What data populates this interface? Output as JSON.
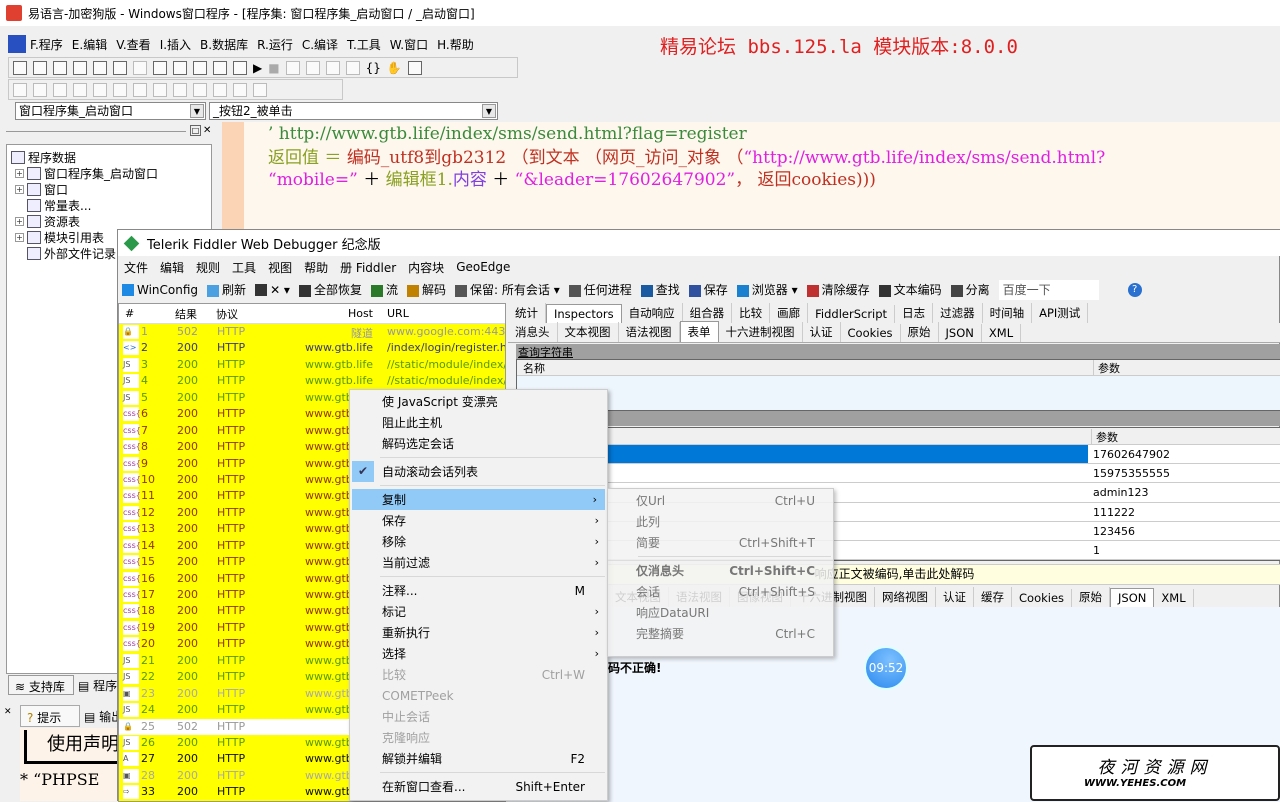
{
  "ide": {
    "title": "易语言-加密狗版 - Windows窗口程序 - [程序集: 窗口程序集_启动窗口 / _启动窗口]",
    "menu": [
      "F.程序",
      "E.编辑",
      "V.查看",
      "I.插入",
      "B.数据库",
      "R.运行",
      "C.编译",
      "T.工具",
      "W.窗口",
      "H.帮助"
    ],
    "forum_banner": "精易论坛 bbs.125.la 模块版本:8.0.0",
    "combo_class": "窗口程序集_启动窗口",
    "combo_method": "_按钮2_被单击",
    "tree": [
      {
        "label": "程序数据",
        "expand": false,
        "indent": 0
      },
      {
        "label": "窗口程序集_启动窗口",
        "expand": true,
        "indent": 1
      },
      {
        "label": "窗口",
        "expand": true,
        "indent": 1
      },
      {
        "label": "常量表...",
        "expand": false,
        "indent": 1
      },
      {
        "label": "资源表",
        "expand": true,
        "indent": 1
      },
      {
        "label": "模块引用表",
        "expand": true,
        "indent": 1
      },
      {
        "label": "外部文件记录",
        "expand": false,
        "indent": 1
      }
    ],
    "code": {
      "line1": "’ http://www.gtb.life/index/sms/send.html?flag=register",
      "l2_a": "返回值 ＝ ",
      "l2_b": "编码_utf8到gb2312 （到文本 （网页_访问_对象 （",
      "l2_c": "“http://www.gtb.life/index/sms/send.html?",
      "l3_a": "“mobile=”",
      "l3_b": " ＋ ",
      "l3_c": "编辑框1.",
      "l3_d": "内容",
      "l3_e": " ＋ ",
      "l3_f": "“&leader=17602647902”",
      "l3_g": "， 返回cookies)))"
    },
    "bottom_tabs": [
      "支持库",
      "程序"
    ],
    "bottom_tabs2": [
      "提示",
      "输出"
    ],
    "notice_title": "使用声明",
    "notice_line": "* “PHPSE"
  },
  "fiddler": {
    "title": "Telerik Fiddler Web Debugger 纪念版",
    "menu": [
      "文件",
      "编辑",
      "规则",
      "工具",
      "视图",
      "帮助",
      "册 Fiddler",
      "内容块",
      "GeoEdge"
    ],
    "toolbar": [
      "WinConfig",
      "刷新",
      "✕ ▾",
      "全部恢复",
      "流",
      "解码",
      "保留: 所有会话 ▾",
      "任何进程",
      "查找",
      "保存",
      "浏览器 ▾",
      "清除缓存",
      "文本编码",
      "分离"
    ],
    "search_placeholder": "百度一下",
    "columns": [
      "#",
      "结果",
      "协议",
      "Host",
      "URL"
    ],
    "sessions": [
      {
        "n": "1",
        "r": "502",
        "p": "HTTP",
        "h": "隧道",
        "u": "www.google.com:443",
        "t": "tun",
        "icon": "lock"
      },
      {
        "n": "2",
        "r": "200",
        "p": "HTTP",
        "h": "www.gtb.life",
        "u": "/index/login/register.html",
        "t": "html",
        "icon": "html"
      },
      {
        "n": "3",
        "r": "200",
        "p": "HTTP",
        "h": "www.gtb.life",
        "u": "//static/module/index/js/j",
        "t": "js",
        "icon": "js"
      },
      {
        "n": "4",
        "r": "200",
        "p": "HTTP",
        "h": "www.gtb.life",
        "u": "//static/module/index/js/b",
        "t": "js",
        "icon": "js"
      },
      {
        "n": "5",
        "r": "200",
        "p": "HTTP",
        "h": "www.gtb.life",
        "u": "",
        "t": "js",
        "icon": "js"
      },
      {
        "n": "6",
        "r": "200",
        "p": "HTTP",
        "h": "www.gtb.life",
        "u": "",
        "t": "css",
        "icon": "css"
      },
      {
        "n": "7",
        "r": "200",
        "p": "HTTP",
        "h": "www.gtb.life",
        "u": "",
        "t": "css",
        "icon": "css"
      },
      {
        "n": "8",
        "r": "200",
        "p": "HTTP",
        "h": "www.gtb.life",
        "u": "",
        "t": "css",
        "icon": "css"
      },
      {
        "n": "9",
        "r": "200",
        "p": "HTTP",
        "h": "www.gtb.life",
        "u": "",
        "t": "css",
        "icon": "css"
      },
      {
        "n": "10",
        "r": "200",
        "p": "HTTP",
        "h": "www.gtb.life",
        "u": "",
        "t": "css",
        "icon": "css"
      },
      {
        "n": "11",
        "r": "200",
        "p": "HTTP",
        "h": "www.gtb.life",
        "u": "",
        "t": "css",
        "icon": "css"
      },
      {
        "n": "12",
        "r": "200",
        "p": "HTTP",
        "h": "www.gtb.life",
        "u": "",
        "t": "css",
        "icon": "css"
      },
      {
        "n": "13",
        "r": "200",
        "p": "HTTP",
        "h": "www.gtb.life",
        "u": "",
        "t": "css",
        "icon": "css"
      },
      {
        "n": "14",
        "r": "200",
        "p": "HTTP",
        "h": "www.gtb.life",
        "u": "",
        "t": "css",
        "icon": "css"
      },
      {
        "n": "15",
        "r": "200",
        "p": "HTTP",
        "h": "www.gtb.life",
        "u": "",
        "t": "css",
        "icon": "css"
      },
      {
        "n": "16",
        "r": "200",
        "p": "HTTP",
        "h": "www.gtb.life",
        "u": "",
        "t": "css",
        "icon": "css"
      },
      {
        "n": "17",
        "r": "200",
        "p": "HTTP",
        "h": "www.gtb.life",
        "u": "",
        "t": "css",
        "icon": "css"
      },
      {
        "n": "18",
        "r": "200",
        "p": "HTTP",
        "h": "www.gtb.life",
        "u": "",
        "t": "css",
        "icon": "css"
      },
      {
        "n": "19",
        "r": "200",
        "p": "HTTP",
        "h": "www.gtb.life",
        "u": "",
        "t": "css",
        "icon": "css"
      },
      {
        "n": "20",
        "r": "200",
        "p": "HTTP",
        "h": "www.gtb.life",
        "u": "",
        "t": "css",
        "icon": "css"
      },
      {
        "n": "21",
        "r": "200",
        "p": "HTTP",
        "h": "www.gtb.life",
        "u": "",
        "t": "js",
        "icon": "js"
      },
      {
        "n": "22",
        "r": "200",
        "p": "HTTP",
        "h": "www.gtb.life",
        "u": "",
        "t": "js",
        "icon": "js"
      },
      {
        "n": "23",
        "r": "200",
        "p": "HTTP",
        "h": "www.gtb.life",
        "u": "",
        "t": "img",
        "icon": "image"
      },
      {
        "n": "24",
        "r": "200",
        "p": "HTTP",
        "h": "www.gtb.life",
        "u": "",
        "t": "js",
        "icon": "js"
      },
      {
        "n": "25",
        "r": "502",
        "p": "HTTP",
        "h": "",
        "u": "",
        "t": "tun",
        "icon": "lock",
        "white": true
      },
      {
        "n": "26",
        "r": "200",
        "p": "HTTP",
        "h": "www.gtb.life",
        "u": "",
        "t": "js",
        "icon": "js"
      },
      {
        "n": "27",
        "r": "200",
        "p": "HTTP",
        "h": "www.gtb.life",
        "u": "",
        "t": "blk",
        "icon": "font"
      },
      {
        "n": "28",
        "r": "200",
        "p": "HTTP",
        "h": "www.gtb.life",
        "u": "",
        "t": "img",
        "icon": "image"
      },
      {
        "n": "33",
        "r": "200",
        "p": "HTTP",
        "h": "www.gtb.life",
        "u": "",
        "t": "blk",
        "icon": "redirect"
      }
    ],
    "main_tabs": [
      "统计",
      "Inspectors",
      "自动响应",
      "组合器",
      "比较",
      "画廊",
      "FiddlerScript",
      "日志",
      "过滤器",
      "时间轴",
      "API测试"
    ],
    "main_tab_selected": 1,
    "request_tabs": [
      "消息头",
      "文本视图",
      "语法视图",
      "表单",
      "十六进制视图",
      "认证",
      "Cookies",
      "原始",
      "JSON",
      "XML"
    ],
    "request_tab_selected": 3,
    "query_string_label": "查询字符串",
    "query_cols": [
      "名称",
      "参数"
    ],
    "body_cols": [
      "参数"
    ],
    "body_params": [
      "17602647902",
      "15975355555",
      "admin123",
      "111222",
      "123456",
      "1"
    ],
    "decode_bar": "响应正文被编码,单击此处解码",
    "response_tabs": [
      "文本视图",
      "语法视图",
      "图像视图",
      "十六进制视图",
      "网络视图",
      "认证",
      "缓存",
      "Cookies",
      "原始",
      "JSON",
      "XML"
    ],
    "response_tab_selected": 9,
    "response_text": "码不正确!"
  },
  "context_menu": [
    {
      "label": "使 JavaScript 变漂亮"
    },
    {
      "label": "阻止此主机"
    },
    {
      "label": "解码选定会话"
    },
    {
      "sep": true
    },
    {
      "label": "自动滚动会话列表",
      "checked": true
    },
    {
      "sep": true
    },
    {
      "label": "复制",
      "sub": true,
      "hl": true
    },
    {
      "label": "保存",
      "sub": true
    },
    {
      "label": "移除",
      "sub": true
    },
    {
      "label": "当前过滤",
      "sub": true
    },
    {
      "sep": true
    },
    {
      "label": "注释...",
      "sc": "M"
    },
    {
      "label": "标记",
      "sub": true
    },
    {
      "label": "重新执行",
      "sub": true
    },
    {
      "label": "选择",
      "sub": true
    },
    {
      "label": "比较",
      "sc": "Ctrl+W",
      "dis": true
    },
    {
      "label": "COMETPeek",
      "dis": true
    },
    {
      "label": "中止会话",
      "dis": true
    },
    {
      "label": "克隆响应",
      "dis": true
    },
    {
      "label": "解锁并编辑",
      "sc": "F2"
    },
    {
      "sep": true
    },
    {
      "label": "在新窗口查看...",
      "sc": "Shift+Enter"
    }
  ],
  "copy_submenu": [
    {
      "label": "仅Url",
      "sc": "Ctrl+U"
    },
    {
      "label": "此列"
    },
    {
      "label": "简要",
      "sc": "Ctrl+Shift+T"
    },
    {
      "sep": true
    },
    {
      "label": "仅消息头",
      "sc": "Ctrl+Shift+C",
      "bold": true
    },
    {
      "label": "会话",
      "sc": "Ctrl+Shift+S"
    },
    {
      "label": "响应DataURI"
    },
    {
      "label": "完整摘要",
      "sc": "Ctrl+C"
    }
  ],
  "clock": "09:52",
  "watermark": {
    "title": "夜河资源网",
    "url": "WWW.YEHES.COM"
  },
  "colors": {
    "session_highlight": "#ffff00",
    "menu_highlight": "#91c9f7",
    "selected_row": "#0078d7",
    "forum_red": "#e02020"
  }
}
